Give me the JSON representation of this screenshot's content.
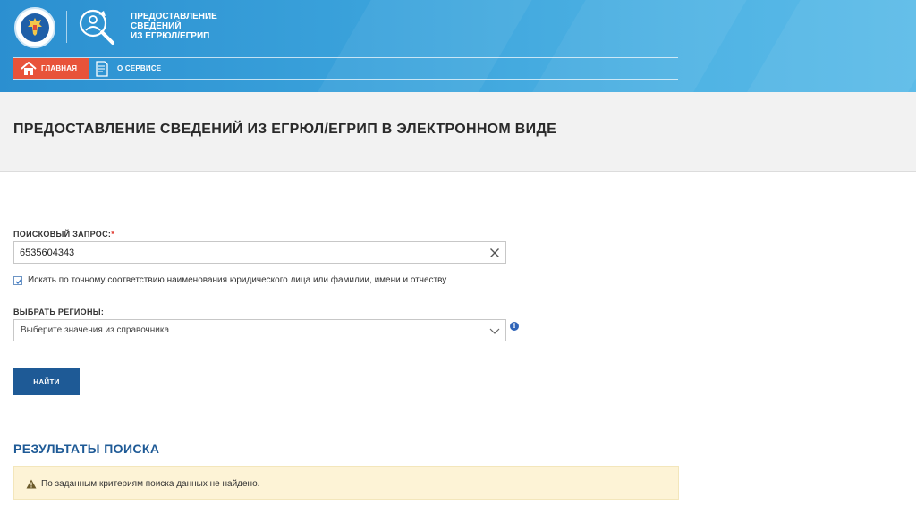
{
  "header": {
    "service_title_lines": [
      "ПРЕДОСТАВЛЕНИЕ",
      "СВЕДЕНИЙ",
      "ИЗ ЕГРЮЛ/ЕГРИП"
    ],
    "nav": [
      {
        "label": "ГЛАВНАЯ",
        "icon": "home-icon",
        "active": true
      },
      {
        "label": "О СЕРВИСЕ",
        "icon": "document-icon",
        "active": false
      }
    ],
    "colors": {
      "header_blue": "#3aa2db",
      "nav_active": "#e8533a"
    }
  },
  "page": {
    "title": "ПРЕДОСТАВЛЕНИЕ СВЕДЕНИЙ ИЗ ЕГРЮЛ/ЕГРИП В ЭЛЕКТРОННОМ ВИДЕ"
  },
  "form": {
    "query_label": "ПОИСКОВЫЙ ЗАПРОС:",
    "query_required_mark": "*",
    "query_value": "6535604343",
    "exact_match_checked": true,
    "exact_match_label": "Искать по точному соответствию наименования юридического лица или фамилии, имени и отчеству",
    "regions_label": "ВЫБРАТЬ РЕГИОНЫ:",
    "regions_placeholder": "Выберите значения из справочника",
    "info_symbol": "i",
    "submit_label": "НАЙТИ",
    "colors": {
      "button": "#1e5a96",
      "required": "#e0382f"
    }
  },
  "results": {
    "title": "РЕЗУЛЬТАТЫ ПОИСКА",
    "message": "По заданным критериям поиска данных не найдено.",
    "message_icon": "warning-icon",
    "colors": {
      "alert_bg": "#fdf3d6"
    }
  }
}
